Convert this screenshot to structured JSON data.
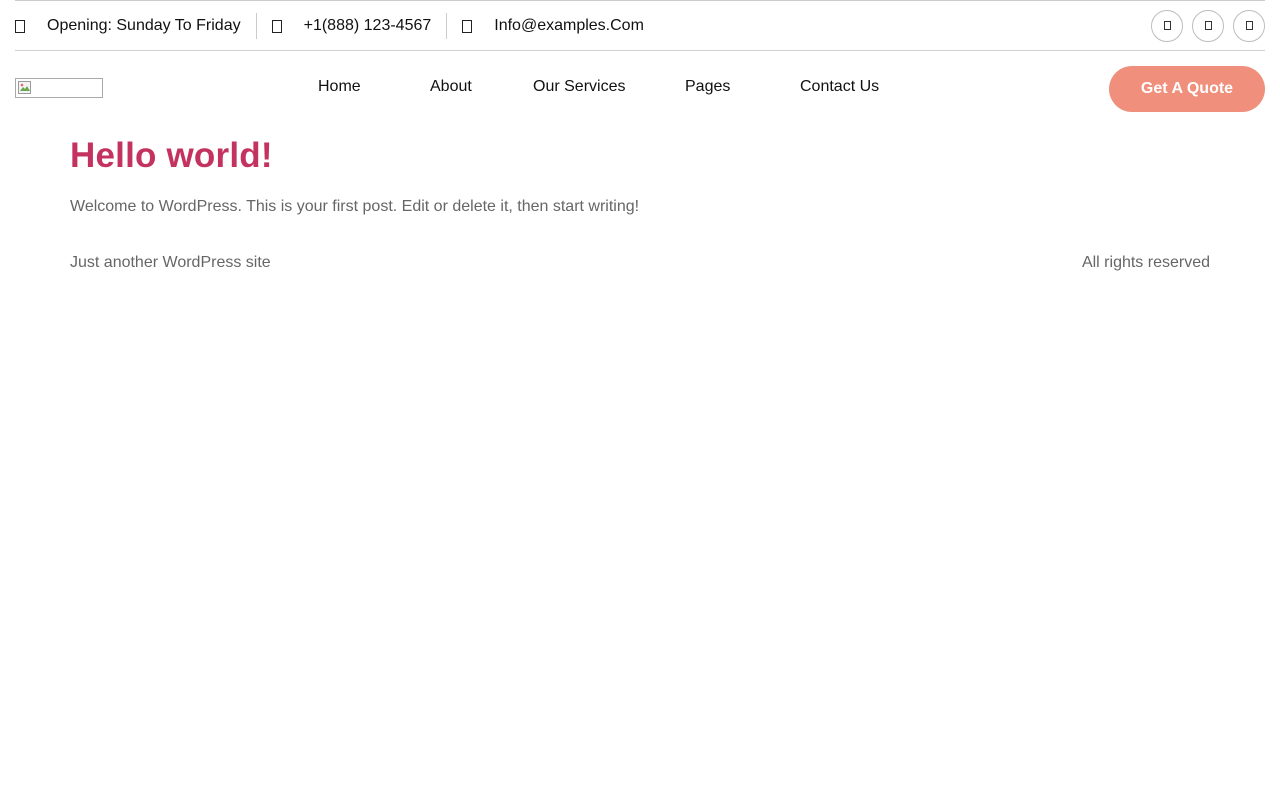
{
  "topbar": {
    "hours": "Opening: Sunday To Friday",
    "phone": "+1(888) 123-4567",
    "email": "Info@examples.Com",
    "hours_icon": "clock-icon",
    "phone_icon": "phone-icon",
    "email_icon": "mail-icon",
    "socials": [
      "facebook-icon",
      "twitter-icon",
      "instagram-icon"
    ]
  },
  "header": {
    "logo_icon": "broken-image-icon",
    "nav": [
      "Home",
      "About",
      "Our Services",
      "Pages",
      "Contact Us"
    ],
    "cta": "Get A Quote"
  },
  "post": {
    "title": "Hello world!",
    "body": "Welcome to WordPress. This is your first post. Edit or delete it, then start writing!"
  },
  "footer": {
    "tagline": "Just another WordPress site",
    "rights": "All rights reserved"
  },
  "colors": {
    "accent": "#c4325f",
    "cta_bg": "#ef8f7c",
    "muted_text": "#666666"
  }
}
